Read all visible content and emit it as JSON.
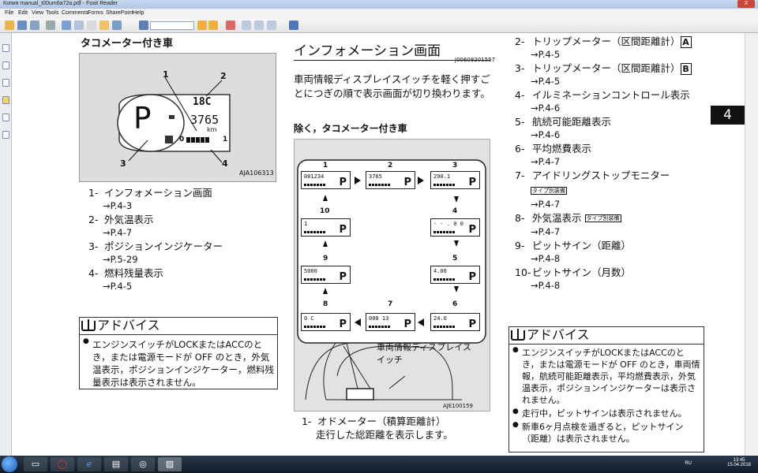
{
  "window": {
    "title": "Копия manual_t00um6a72a.pdf - Foxit Reader",
    "close_label": "X",
    "menu": [
      "File",
      "Edit",
      "View",
      "Tools",
      "Comments",
      "Forms",
      "SharePoint",
      "Help"
    ]
  },
  "taskbar": {
    "lang": "RU",
    "time": "13:45",
    "date": "15.04.2018"
  },
  "left_column": {
    "heading": "タコメーター付き車",
    "figure": {
      "callouts": [
        "1",
        "2",
        "3",
        "4"
      ],
      "temp": "18C",
      "odo": "3765",
      "unit": "km",
      "gear": "P",
      "fuel_empty": "0",
      "fuel_full": "1",
      "code": "AJA106313"
    },
    "items": [
      {
        "num": "1-",
        "text": "インフォメーション画面",
        "ref": "→P.4-3"
      },
      {
        "num": "2-",
        "text": "外気温表示",
        "ref": "→P.4-7"
      },
      {
        "num": "3-",
        "text": "ポジションインジケーター",
        "ref": "→P.5-29"
      },
      {
        "num": "4-",
        "text": "燃料残量表示",
        "ref": "→P.4-5"
      }
    ],
    "advice": {
      "title": "アドバイス",
      "bullets": [
        "エンジンスイッチがLOCKまたはACCのとき，または電源モードが OFF のとき，外気温表示，ポジションインジケーター，燃料残量表示は表示されません。"
      ]
    }
  },
  "middle_column": {
    "heading": "インフォメーション画面",
    "code": "J00608201557",
    "intro": "車両情報ディスプレイスイッチを軽く押すごとにつぎの順で表示画面が切り換わります。",
    "subheading": "除く，タコメーター付き車",
    "diagram": {
      "labels": [
        "1",
        "2",
        "3",
        "4",
        "5",
        "6",
        "7",
        "8",
        "9",
        "10"
      ],
      "screens": [
        "001234",
        "3765",
        "290.1",
        "- - . 0 0",
        "4.00",
        "24.0",
        "000 13",
        "0 C",
        "5000",
        "1"
      ],
      "switch_label": "車両情報ディスプレイスイッチ",
      "code": "AJE100159"
    },
    "items": [
      {
        "num": "1-",
        "text": "オドメーター（積算距離計）",
        "desc": "走行した総距離を表示します。"
      }
    ]
  },
  "right_column": {
    "chapter": "4",
    "items": [
      {
        "num": "2-",
        "text": "トリップメーター（区間距離計）",
        "box": "A",
        "ref": "→P.4-5"
      },
      {
        "num": "3-",
        "text": "トリップメーター（区間距離計）",
        "box": "B",
        "ref": "→P.4-5"
      },
      {
        "num": "4-",
        "text": "イルミネーションコントロール表示",
        "ref": "→P.4-6"
      },
      {
        "num": "5-",
        "text": "航続可能距離表示",
        "ref": "→P.4-6"
      },
      {
        "num": "6-",
        "text": "平均燃費表示",
        "ref": "→P.4-7"
      },
      {
        "num": "7-",
        "text": "アイドリングストップモニター",
        "tag": "タイプ別装備",
        "ref": "→P.4-7"
      },
      {
        "num": "8-",
        "text": "外気温表示",
        "tag": "タイプ別装備",
        "ref": "→P.4-7"
      },
      {
        "num": "9-",
        "text": "ピットサイン（距離）",
        "ref": "→P.4-8"
      },
      {
        "num": "10-",
        "text": "ピットサイン（月数）",
        "ref": "→P.4-8"
      }
    ],
    "advice": {
      "title": "アドバイス",
      "bullets": [
        "エンジンスイッチがLOCKまたはACCのとき，または電源モードが OFF のとき，車両情報，航続可能距離表示，平均燃費表示，外気温表示，ポジションインジケーターは表示されません。",
        "走行中，ピットサインは表示されません。",
        "新車6ヶ月点検を過ぎると，ピットサイン（距離）は表示されません。"
      ]
    }
  }
}
